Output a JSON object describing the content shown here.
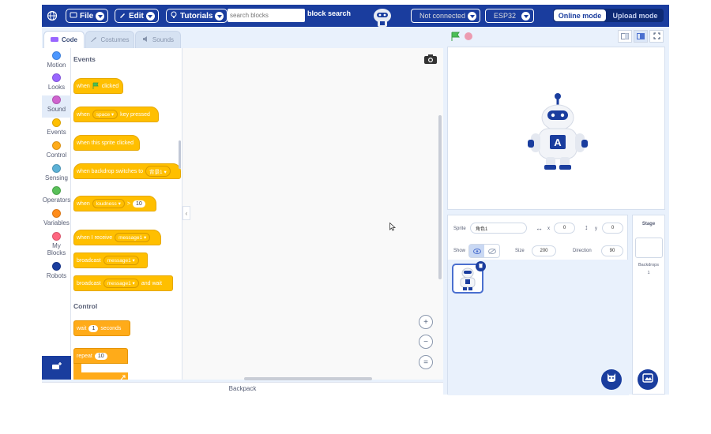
{
  "topbar": {
    "file_label": "File",
    "edit_label": "Edit",
    "tutorials_label": "Tutorials",
    "search_placeholder": "search blocks",
    "search_button": "block search",
    "connection_status": "Not connected",
    "device": "ESP32",
    "mode_online": "Online mode",
    "mode_upload": "Upload mode"
  },
  "tabs": {
    "code": "Code",
    "costumes": "Costumes",
    "sounds": "Sounds"
  },
  "categories": [
    {
      "label": "Motion",
      "color": "#4c97ff"
    },
    {
      "label": "Looks",
      "color": "#9966ff"
    },
    {
      "label": "Sound",
      "color": "#cf63cf"
    },
    {
      "label": "Events",
      "color": "#ffbf00"
    },
    {
      "label": "Control",
      "color": "#ffab19"
    },
    {
      "label": "Sensing",
      "color": "#5cb1d6"
    },
    {
      "label": "Operators",
      "color": "#59c059"
    },
    {
      "label": "Variables",
      "color": "#ff8c1a"
    },
    {
      "label": "My Blocks",
      "color": "#ff6680"
    },
    {
      "label": "Robots",
      "color": "#1a3d9e"
    }
  ],
  "palette": {
    "events_title": "Events",
    "when_flag_when": "when",
    "when_flag_clicked": "clicked",
    "key_when": "when",
    "key_value": "space",
    "key_pressed": "key pressed",
    "sprite_clicked": "when this sprite clicked",
    "backdrop_when": "when backdrop switches to",
    "backdrop_value": "背景1",
    "loudness_when": "when",
    "loudness_value": "loudness",
    "loudness_op": ">",
    "loudness_num": "10",
    "receive_label": "when I receive",
    "receive_value": "message1",
    "broadcast_label": "broadcast",
    "broadcast_value": "message1",
    "broadcast_wait_label": "broadcast",
    "broadcast_wait_value": "message1",
    "broadcast_wait_suffix": "and wait",
    "control_title": "Control",
    "wait_label": "wait",
    "wait_num": "1",
    "wait_suffix": "seconds",
    "repeat_label": "repeat",
    "repeat_num": "10"
  },
  "zoom": {
    "in": "+",
    "out": "−",
    "reset": "="
  },
  "backpack_label": "Backpack",
  "sprite_info": {
    "sprite_label": "Sprite",
    "sprite_name": "角色1",
    "x_label": "x",
    "x_value": "0",
    "y_label": "y",
    "y_value": "0",
    "show_label": "Show",
    "size_label": "Size",
    "size_value": "200",
    "direction_label": "Direction",
    "direction_value": "90"
  },
  "stage_panel": {
    "title": "Stage",
    "backdrops_label": "Backdrops",
    "backdrops_count": "1"
  },
  "colors": {
    "topbar": "#1a3d9e",
    "events_block": "#ffbf00",
    "control_block": "#ffab19",
    "flag": "#4cbf56"
  }
}
